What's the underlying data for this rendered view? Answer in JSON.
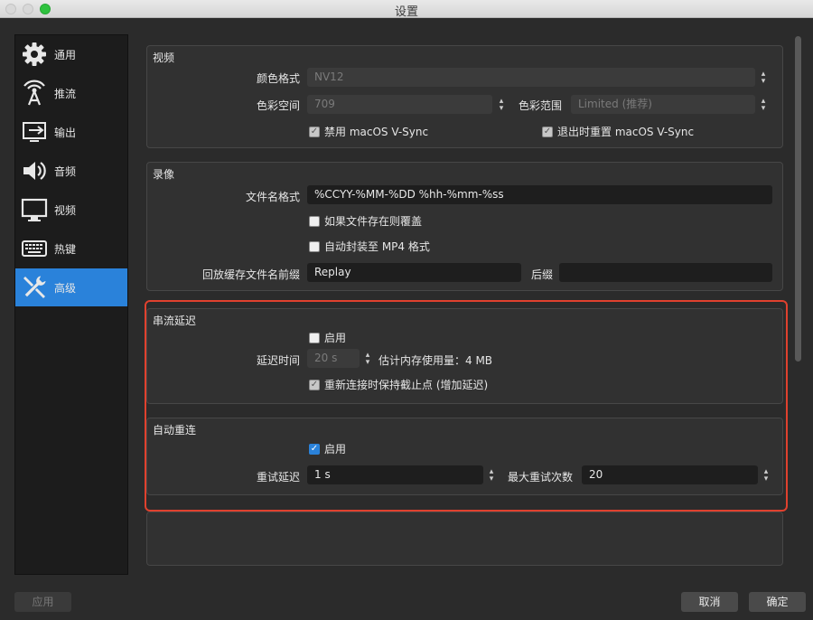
{
  "window": {
    "title": "设置"
  },
  "sidebar": {
    "items": [
      {
        "label": "通用",
        "icon": "gear-icon"
      },
      {
        "label": "推流",
        "icon": "broadcast-icon"
      },
      {
        "label": "输出",
        "icon": "output-icon"
      },
      {
        "label": "音频",
        "icon": "speaker-icon"
      },
      {
        "label": "视频",
        "icon": "monitor-icon"
      },
      {
        "label": "热键",
        "icon": "keyboard-icon"
      },
      {
        "label": "高级",
        "icon": "tools-icon",
        "active": true
      }
    ]
  },
  "video": {
    "title": "视频",
    "color_format_label": "颜色格式",
    "color_format_value": "NV12",
    "color_space_label": "色彩空间",
    "color_space_value": "709",
    "color_range_label": "色彩范围",
    "color_range_value": "Limited (推荐)",
    "disable_vsync_label": "禁用 macOS V-Sync",
    "reset_vsync_label": "退出时重置 macOS V-Sync"
  },
  "recording": {
    "title": "录像",
    "filename_format_label": "文件名格式",
    "filename_format_value": "%CCYY-%MM-%DD %hh-%mm-%ss",
    "overwrite_label": "如果文件存在则覆盖",
    "remux_label": "自动封装至 MP4 格式",
    "replay_prefix_label": "回放缓存文件名前缀",
    "replay_prefix_value": "Replay",
    "suffix_label": "后缀",
    "suffix_value": ""
  },
  "stream_delay": {
    "title": "串流延迟",
    "enable_label": "启用",
    "duration_label": "延迟时间",
    "duration_value": "20 s",
    "memory_estimate": "估计内存使用量：4 MB",
    "preserve_label": "重新连接时保持截止点 (增加延迟)"
  },
  "auto_reconnect": {
    "title": "自动重连",
    "enable_label": "启用",
    "retry_delay_label": "重试延迟",
    "retry_delay_value": "1 s",
    "max_retries_label": "最大重试次数",
    "max_retries_value": "20"
  },
  "buttons": {
    "apply": "应用",
    "cancel": "取消",
    "ok": "确定"
  },
  "colors": {
    "accent": "#2a82da",
    "highlight": "#e0412e",
    "background": "#2b2b2b"
  }
}
